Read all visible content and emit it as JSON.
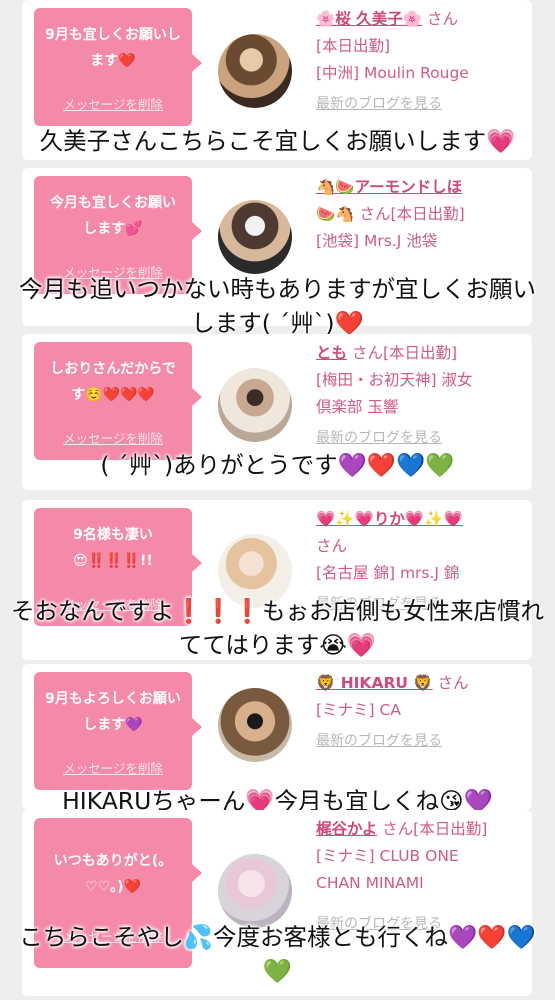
{
  "entries": [
    {
      "message": "9月も宜しくお願いします❤️",
      "delete_label": "メッセージを削除",
      "name": "🌸桜 久美子🌸",
      "san": "さん",
      "lines": [
        "[本日出勤]",
        "[中洲] Moulin Rouge"
      ],
      "blog_label": "最新のブログを見る",
      "reply": "久美子さんこちらこそ宜しくお願いします💗"
    },
    {
      "message": "今月も宜しくお願いします💕",
      "delete_label": "メッセージを削除",
      "name": "🐴🍉アーモンドしほ",
      "san": "🍉🐴 さん[本日出勤]",
      "lines": [
        "[池袋] Mrs.J 池袋"
      ],
      "blog_label": "最新のブログを見る",
      "reply": "今月も追いつかない時もありますが宜しくお願いします( ´艸`)❤️"
    },
    {
      "message": "しおりさんだからです☺️❤️❤️❤️",
      "delete_label": "メッセージを削除",
      "name": "とも",
      "san": "さん[本日出勤]",
      "lines": [
        "[梅田・お初天神] 淑女",
        "倶楽部 玉響"
      ],
      "blog_label": "最新のブログを見る",
      "reply": "( ´艸`)ありがとうです💜❤️💙💚"
    },
    {
      "message": "9名様も凄い😍‼️‼️‼️!!",
      "delete_label": "メッセージを削除",
      "name": "💗✨💗りか💗✨💗",
      "san": "さん",
      "lines": [
        "[名古屋 錦] mrs.J 錦"
      ],
      "blog_label": "最新のブログを見る",
      "reply": "そおなんですよ❗️❗️❗️もぉお店側も女性来店慣れててはります😭💗"
    },
    {
      "message": "9月もよろしくお願いします💜",
      "delete_label": "メッセージを削除",
      "name": "🦁 HIKARU 🦁",
      "san": "さん",
      "lines": [
        "[ミナミ] CA"
      ],
      "blog_label": "最新のブログを見る",
      "reply": "HIKARUちゃーん💗今月も宜しくね😘💜💜"
    },
    {
      "message": "いつもありがと(。♡♡。)❤️",
      "delete_label": "メッセージを削除",
      "name": "梶谷かよ",
      "san": "さん[本日出勤]",
      "lines": [
        "[ミナミ] CLUB ONE",
        "CHAN MINAMI"
      ],
      "blog_label": "最新のブログを見る",
      "reply": "こちらこそやし💦今度お客様とも行くね💜❤️💙💚"
    }
  ],
  "colors": {
    "accent": "#d1487a",
    "bubble": "#f48aa8",
    "background": "#eeeeee"
  }
}
